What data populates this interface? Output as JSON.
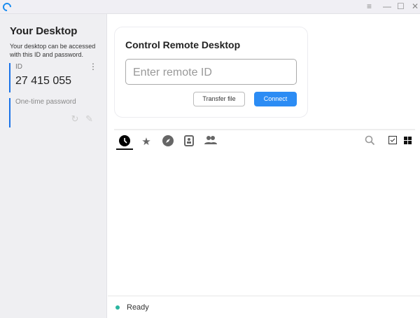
{
  "titlebar": {
    "icons": [
      "app-logo",
      "menu-icon",
      "minimize-icon",
      "maximize-icon",
      "close-icon"
    ]
  },
  "sidebar": {
    "title": "Your Desktop",
    "description": "Your desktop can be accessed with this ID and password.",
    "id_label": "ID",
    "id_value": "27 415 055",
    "password_label": "One-time password"
  },
  "card": {
    "title": "Control Remote Desktop",
    "placeholder": "Enter remote ID",
    "transfer_label": "Transfer file",
    "connect_label": "Connect"
  },
  "tabs": [
    "recent-sessions",
    "favorites",
    "discovered",
    "address-book",
    "group"
  ],
  "status": {
    "text": "Ready",
    "color": "#2bb5a0"
  },
  "accent": "#2c8cf4"
}
